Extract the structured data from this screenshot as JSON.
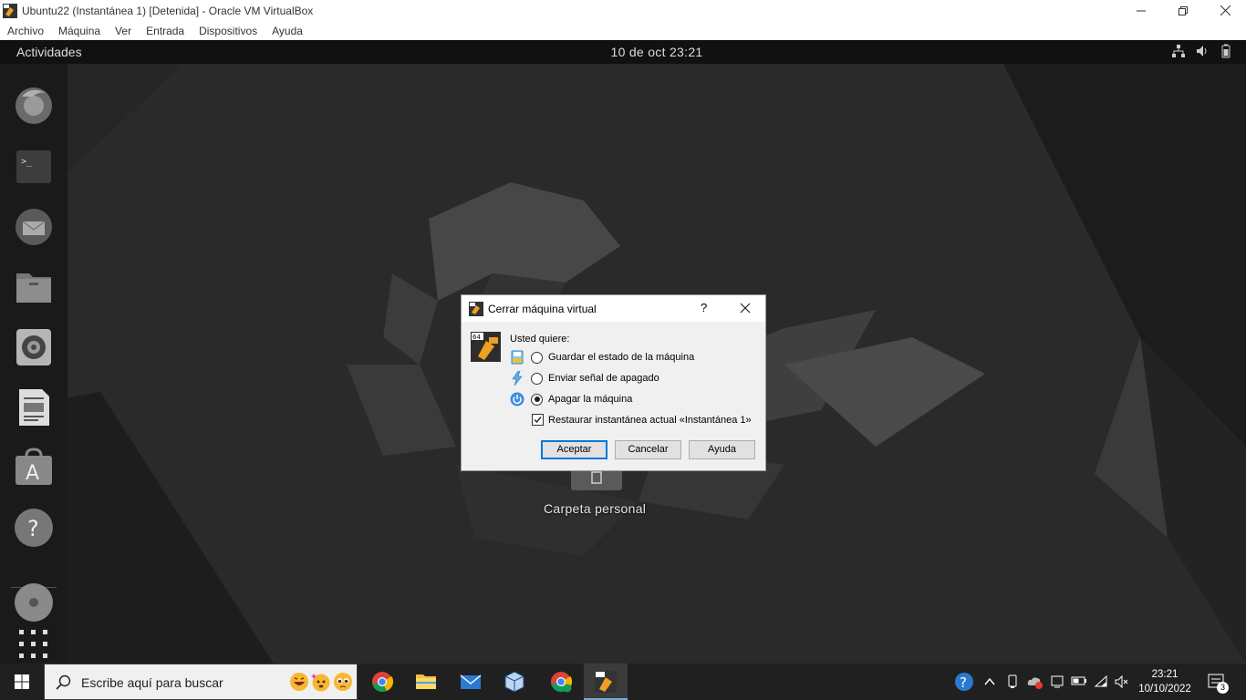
{
  "window": {
    "title": "Ubuntu22 (Instantánea 1) [Detenida] - Oracle VM VirtualBox",
    "menu": [
      "Archivo",
      "Máquina",
      "Ver",
      "Entrada",
      "Dispositivos",
      "Ayuda"
    ]
  },
  "guest": {
    "activities": "Actividades",
    "clock": "10 de oct  23:21",
    "desktop_icon_label": "Carpeta personal",
    "tray_icons": [
      "network-icon",
      "volume-icon",
      "battery-icon"
    ],
    "dock_icons": [
      "firefox-icon",
      "terminal-icon",
      "thunderbird-icon",
      "files-icon",
      "rhythmbox-icon",
      "writer-icon",
      "app-center-icon",
      "help-icon",
      "dvd-icon",
      "show-apps-icon"
    ]
  },
  "dialog": {
    "title": "Cerrar máquina virtual",
    "help_symbol": "?",
    "prompt": "Usted quiere:",
    "options": [
      {
        "label": "Guardar el estado de la máquina",
        "icon": "save-state-icon",
        "selected": false
      },
      {
        "label": "Enviar señal de apagado",
        "icon": "acpi-shutdown-icon",
        "selected": false
      },
      {
        "label": "Apagar la máquina",
        "icon": "power-off-icon",
        "selected": true
      }
    ],
    "restore_checkbox": {
      "label": "Restaurar instantánea actual «Instantánea 1»",
      "checked": true
    },
    "buttons": {
      "ok": "Aceptar",
      "cancel": "Cancelar",
      "help": "Ayuda"
    }
  },
  "taskbar": {
    "search_placeholder": "Escribe aquí para buscar",
    "time": "23:21",
    "date": "10/10/2022",
    "notification_count": "3",
    "accent_color": "#7aa7d8"
  }
}
